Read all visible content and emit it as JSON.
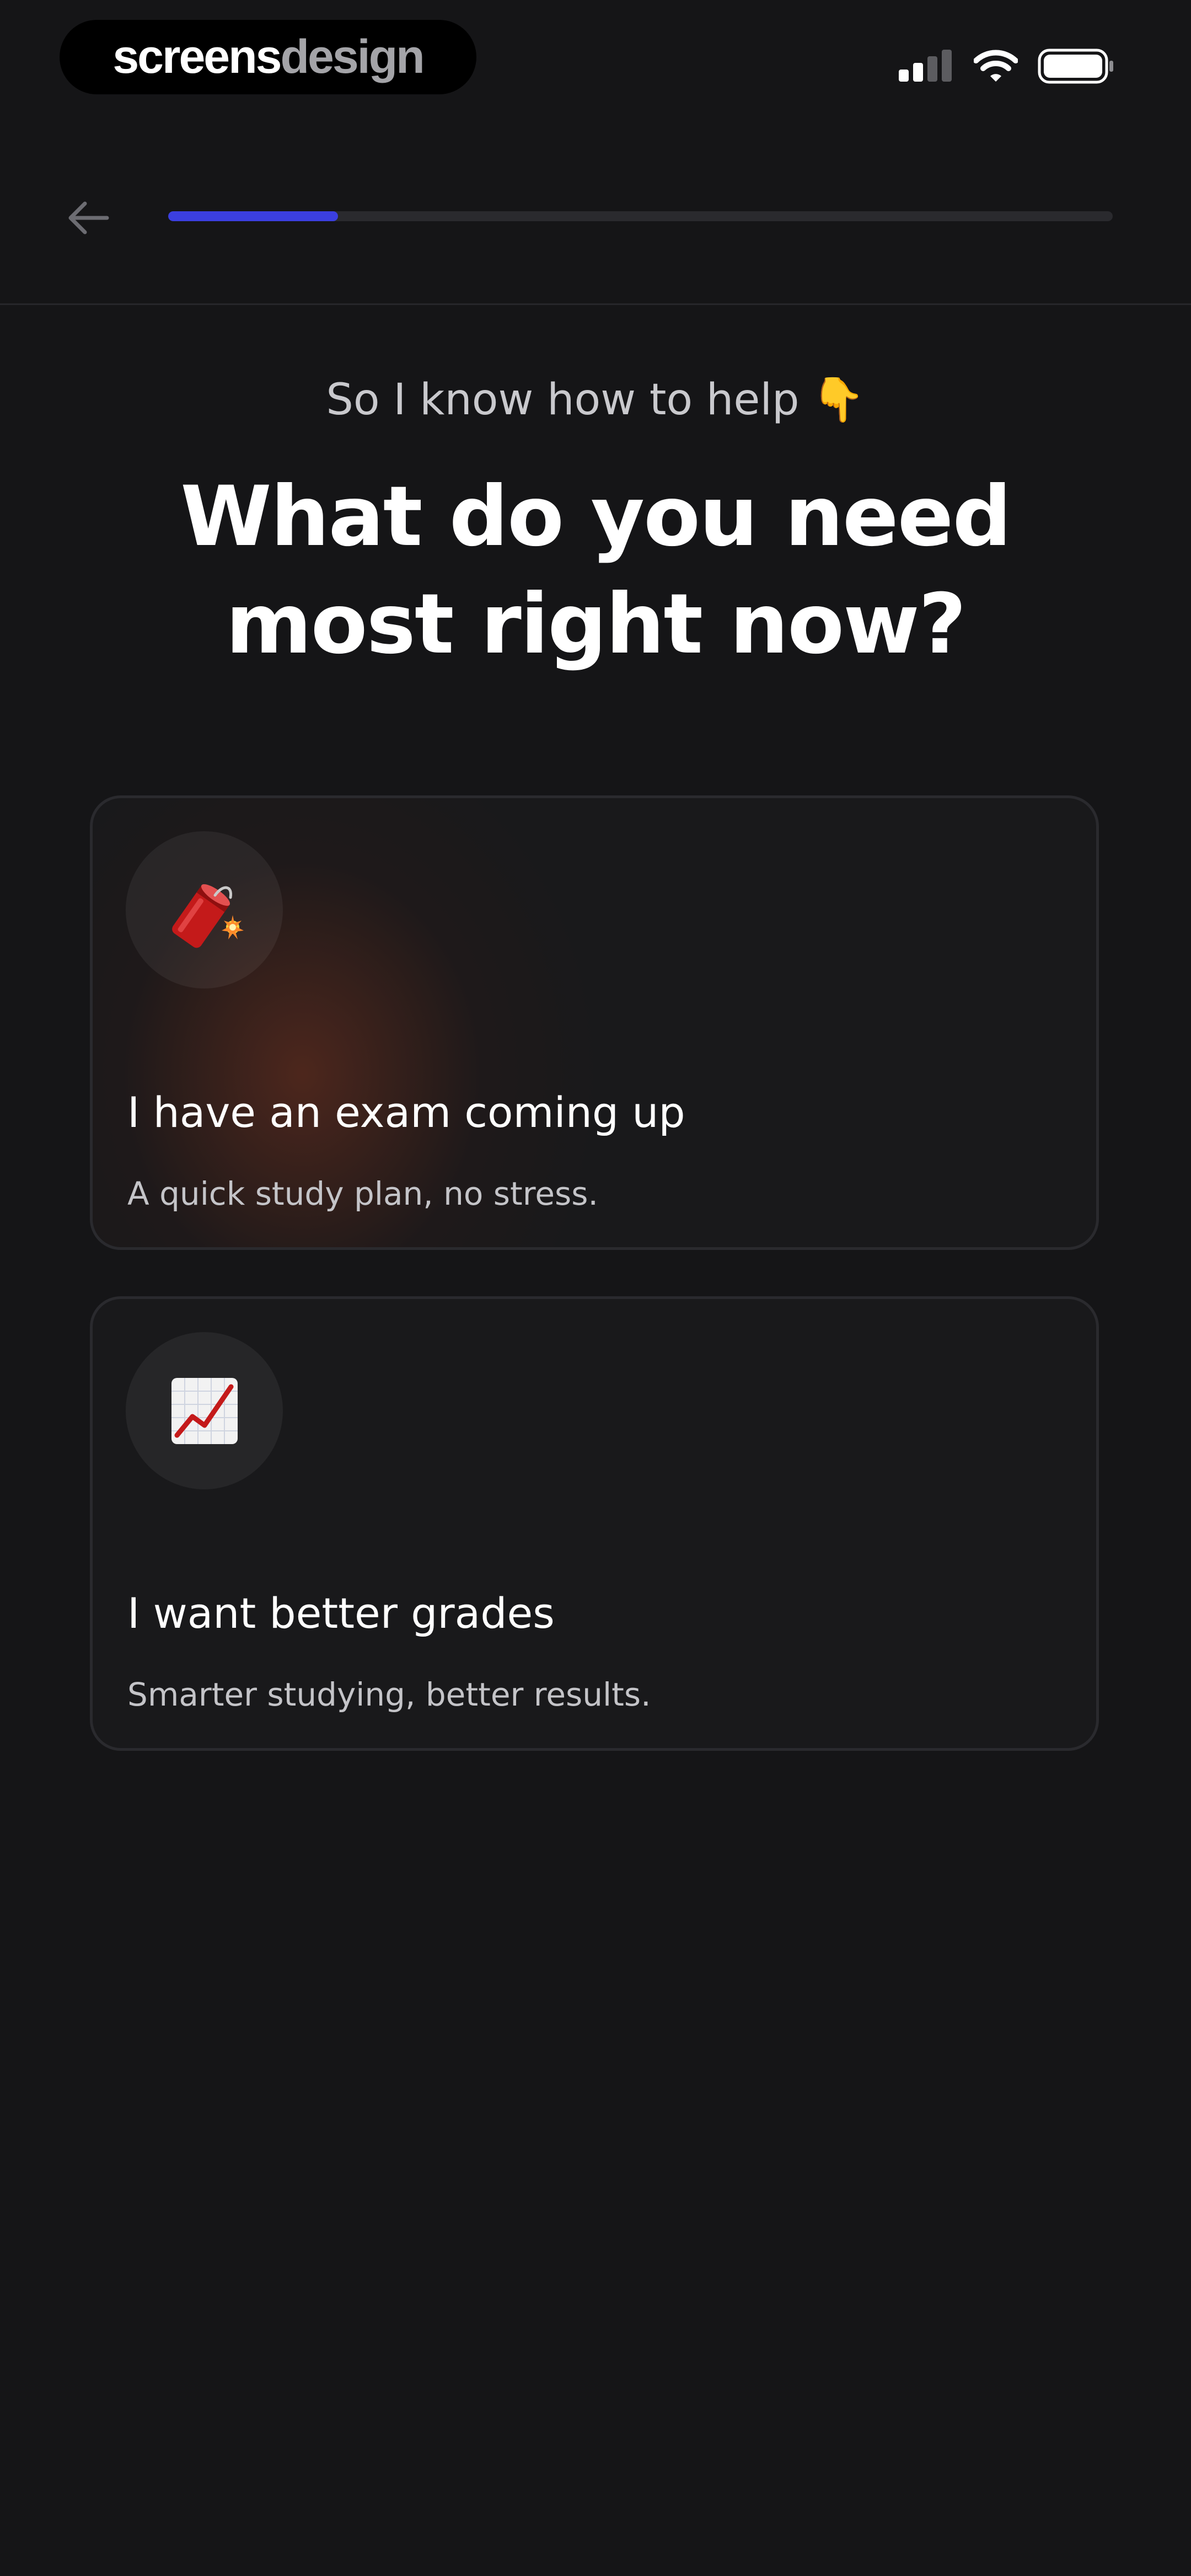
{
  "watermark": {
    "part1": "screens",
    "part2": "design"
  },
  "status_bar": {
    "icons": [
      "cellular-signal-icon",
      "wifi-icon",
      "battery-icon"
    ]
  },
  "nav": {
    "back_icon": "arrow-left-icon",
    "progress_fraction": 0.18,
    "progress_color": "#3b3fe0"
  },
  "header": {
    "subtitle": "So I know how to help",
    "subtitle_emoji": "👇",
    "title": "What do you need most right now?"
  },
  "options": [
    {
      "icon": "firecracker-icon",
      "title": "I have an exam coming up",
      "description": "A quick study plan, no stress."
    },
    {
      "icon": "chart-increasing-icon",
      "title": "I want better grades",
      "description": "Smarter studying, better results."
    }
  ]
}
